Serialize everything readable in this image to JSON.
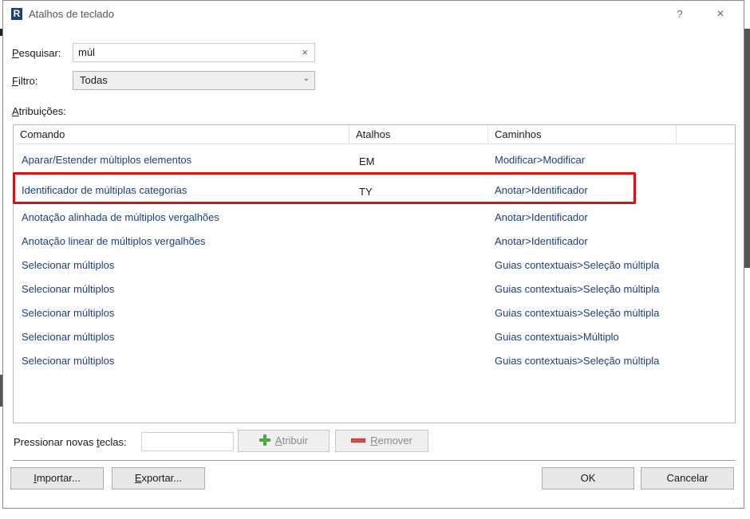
{
  "window": {
    "title": "Atalhos de teclado",
    "app_icon_letter": "R",
    "help_label": "?",
    "close_label": "×"
  },
  "search": {
    "label": "Pesquisar:",
    "label_accel": "P",
    "label_rest": "esquisar:",
    "value": "múl",
    "clear_label": "×"
  },
  "filter": {
    "label_accel": "F",
    "label_rest": "iltro:",
    "value": "Todas",
    "chevron": "⌄"
  },
  "assignments": {
    "label_accel": "A",
    "label_rest": "tribuições:"
  },
  "table": {
    "columns": [
      "Comando",
      "Atalhos",
      "Caminhos"
    ],
    "rows": [
      {
        "command": "Aparar/Estender múltiplos elementos",
        "shortcut": "EM",
        "path": "Modificar>Modificar"
      },
      {
        "command": "Identificador de múltiplas categorias",
        "shortcut": "TY",
        "path": "Anotar>Identificador"
      },
      {
        "command": "Anotação alinhada de múltiplos vergalhões",
        "shortcut": "",
        "path": "Anotar>Identificador"
      },
      {
        "command": "Anotação linear de múltiplos vergalhões",
        "shortcut": "",
        "path": "Anotar>Identificador"
      },
      {
        "command": "Selecionar múltiplos",
        "shortcut": "",
        "path": "Guias contextuais>Seleção múltipla"
      },
      {
        "command": "Selecionar múltiplos",
        "shortcut": "",
        "path": "Guias contextuais>Seleção múltipla"
      },
      {
        "command": "Selecionar múltiplos",
        "shortcut": "",
        "path": "Guias contextuais>Seleção múltipla"
      },
      {
        "command": "Selecionar múltiplos",
        "shortcut": "",
        "path": "Guias contextuais>Múltiplo"
      },
      {
        "command": "Selecionar múltiplos",
        "shortcut": "",
        "path": "Guias contextuais>Seleção múltipla"
      }
    ],
    "highlighted_row": 1
  },
  "new_keys": {
    "label_pre": "Pressionar novas ",
    "label_accel": "t",
    "label_post": "eclas:",
    "value": ""
  },
  "buttons": {
    "assign_accel": "A",
    "assign_rest": "tribuir",
    "remove_accel": "R",
    "remove_rest": "emover",
    "import_accel": "I",
    "import_rest": "mportar...",
    "export_accel": "E",
    "export_rest": "xportar...",
    "ok": "OK",
    "cancel": "Cancelar"
  },
  "colors": {
    "link_blue": "#1f3f7a",
    "highlight_red": "#e01010"
  }
}
